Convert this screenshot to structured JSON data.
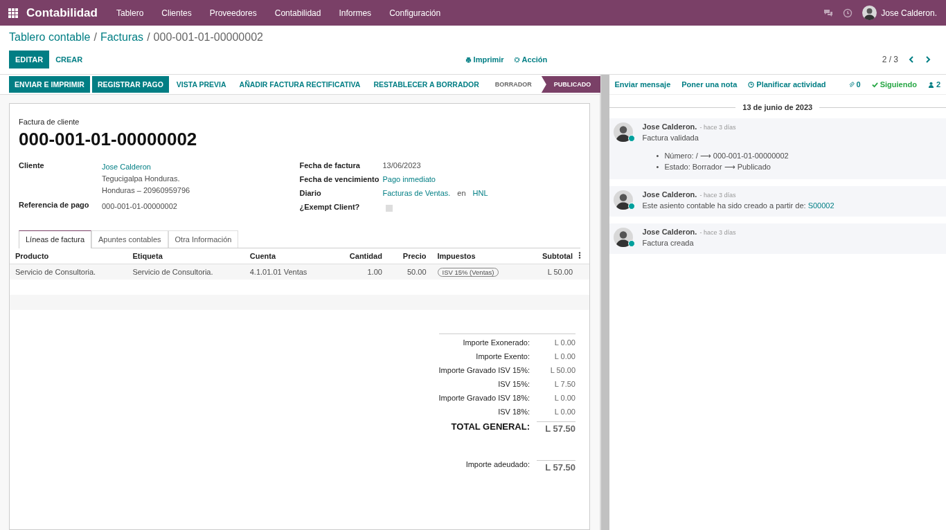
{
  "navbar": {
    "app_title": "Contabilidad",
    "menu": [
      "Tablero",
      "Clientes",
      "Proveedores",
      "Contabilidad",
      "Informes",
      "Configuración"
    ],
    "user": "Jose Calderon."
  },
  "breadcrumb_separator": "/",
  "breadcrumbs": [
    {
      "label": "Tablero contable",
      "current": false
    },
    {
      "label": "Facturas",
      "current": false
    },
    {
      "label": "000-001-01-00000002",
      "current": true
    }
  ],
  "control_buttons": [
    {
      "label": "EDITAR",
      "kind": "primary"
    },
    {
      "label": "CREAR",
      "kind": "link"
    }
  ],
  "print": "Imprimir",
  "action": "Acción",
  "pager": "2 / 3",
  "header_buttons": [
    {
      "label": "ENVIAR E IMPRIMIR",
      "kind": "primary"
    },
    {
      "label": "REGISTRAR PAGO",
      "kind": "primary"
    },
    {
      "label": "VISTA PREVIA",
      "kind": "link"
    },
    {
      "label": "AÑADIR FACTURA RECTIFICATIVA",
      "kind": "link"
    },
    {
      "label": "RESTABLECER A BORRADOR",
      "kind": "link"
    }
  ],
  "stages": [
    {
      "label": "BORRADOR",
      "selected": false
    },
    {
      "label": "PUBLICADO",
      "selected": true
    }
  ],
  "form": {
    "subtitle": "Factura de cliente",
    "title": "000-001-01-00000002",
    "left_fields": [
      {
        "label": "Cliente",
        "kind": "link",
        "lines": [
          "Jose Calderon",
          "Tegucigalpa Honduras.",
          "Honduras – 20960959796"
        ]
      },
      {
        "label": "Referencia de pago",
        "kind": "text",
        "lines": [
          "000-001-01-00000002"
        ]
      }
    ],
    "right_fields": [
      {
        "label": "Fecha de factura",
        "kind": "text",
        "value": "13/06/2023"
      },
      {
        "label": "Fecha de vencimiento",
        "kind": "link",
        "value": "Pago inmediato"
      },
      {
        "label": "Diario",
        "kind": "journal",
        "value": "Facturas de Ventas.",
        "sep": "en",
        "currency": "HNL"
      },
      {
        "label": "¿Exempt Client?",
        "kind": "checkbox",
        "checked": false
      }
    ],
    "tabs": [
      {
        "label": "Líneas de factura",
        "selected": true
      },
      {
        "label": "Apuntes contables",
        "selected": false
      },
      {
        "label": "Otra Información",
        "selected": false
      }
    ],
    "table": {
      "columns": [
        "Producto",
        "Etiqueta",
        "Cuenta",
        "Cantidad",
        "Precio",
        "Impuestos",
        "Subtotal"
      ],
      "rows": [
        {
          "cells": [
            "Servicio de Consultoria.",
            "Servicio de Consultoria.",
            "4.1.01.01 Ventas",
            "1.00",
            "50.00",
            "ISV 15% (Ventas)",
            "L 50.00"
          ]
        }
      ]
    },
    "totals": [
      {
        "label": "Importe Exonerado:",
        "value": "L 0.00"
      },
      {
        "label": "Importe Exento:",
        "value": "L 0.00"
      },
      {
        "label": "Importe Gravado ISV 15%:",
        "value": "L 50.00"
      },
      {
        "label": "ISV 15%:",
        "value": "L 7.50"
      },
      {
        "label": "Importe Gravado ISV 18%:",
        "value": "L 0.00"
      },
      {
        "label": "ISV 18%:",
        "value": "L 0.00"
      }
    ],
    "total_general": {
      "label": "TOTAL GENERAL:",
      "value": "L 57.50"
    },
    "amount_due": {
      "label": "Importe adeudado:",
      "value": "L 57.50"
    }
  },
  "chatter": {
    "actions": [
      "Enviar mensaje",
      "Poner una nota",
      "Planificar actividad"
    ],
    "attachments": "0",
    "following": "Siguiendo",
    "followers": "2",
    "date": "13 de junio de 2023",
    "messages": [
      {
        "author": "Jose Calderon.",
        "time": "- hace 3 días",
        "body": "Factura validada",
        "bullet": "•",
        "changes": [
          "Número: / ⟶ 000-001-01-00000002",
          "Estado: Borrador ⟶ Publicado"
        ]
      },
      {
        "author": "Jose Calderon.",
        "time": "- hace 3 días",
        "body": "Este asiento contable ha sido creado a partir de:",
        "link": "S00002"
      },
      {
        "author": "Jose Calderon.",
        "time": "- hace 3 días",
        "body": "Factura creada"
      }
    ]
  }
}
